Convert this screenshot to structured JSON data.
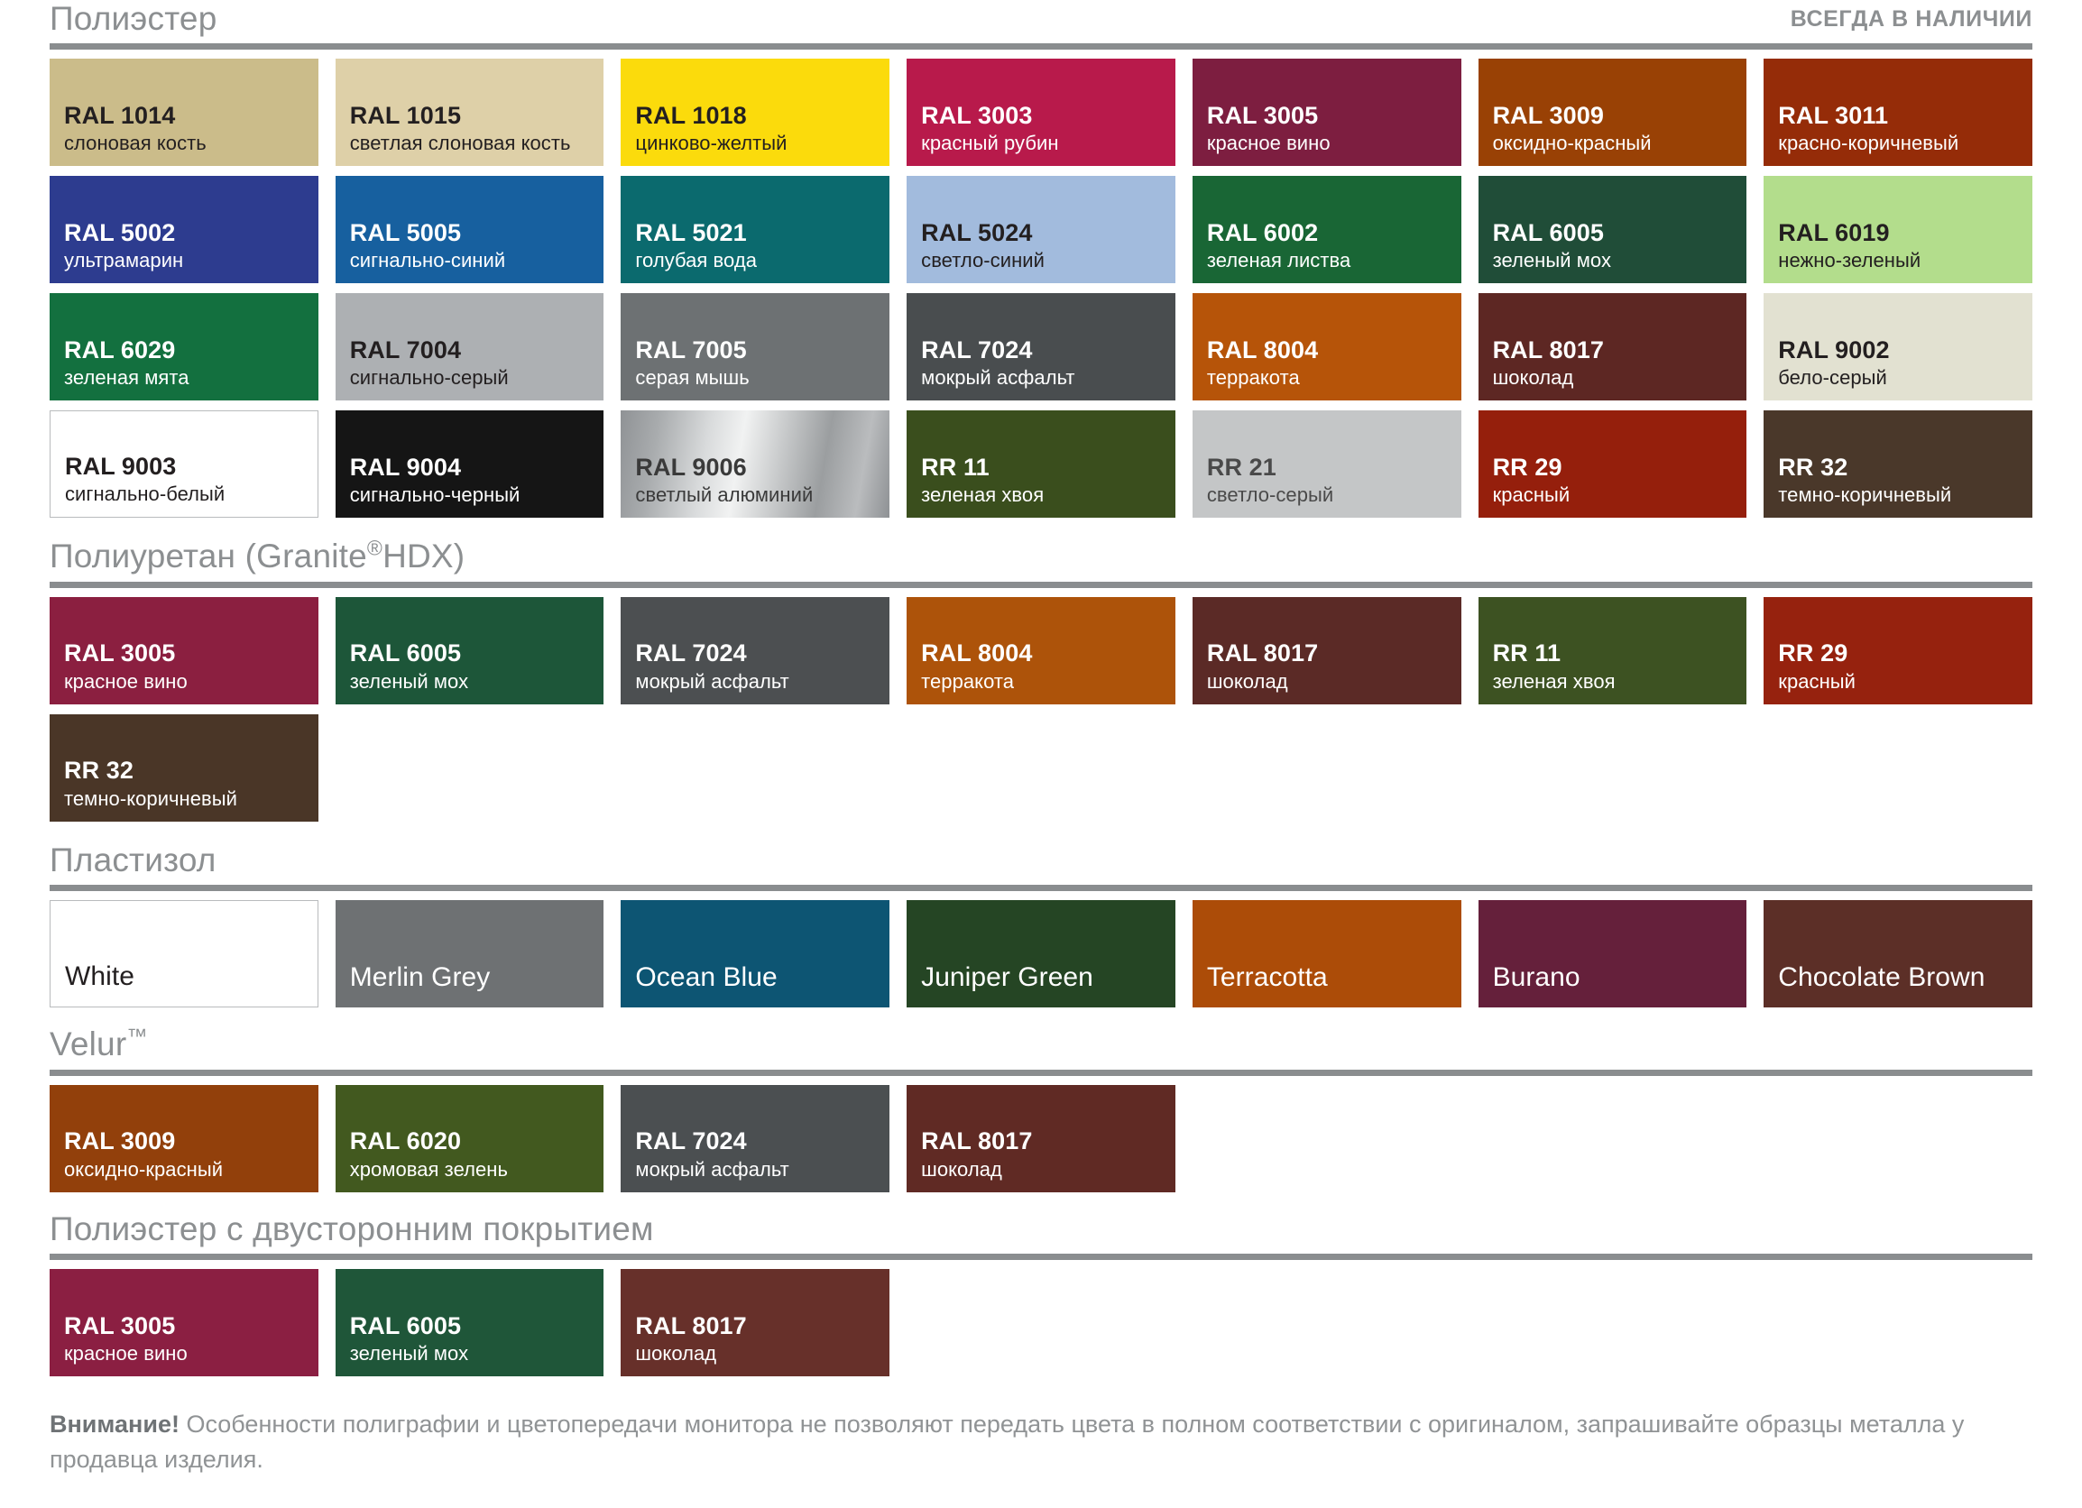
{
  "header": {
    "badge": "ВСЕГДА В НАЛИЧИИ"
  },
  "sections": [
    {
      "id": "polyester",
      "title": "Полиэстер",
      "swatches": [
        {
          "code": "RAL 1014",
          "name": "слоновая кость",
          "bg": "#cbbc8a",
          "fg": "#231f20"
        },
        {
          "code": "RAL 1015",
          "name": "светлая слоновая кость",
          "bg": "#ded0a8",
          "fg": "#231f20"
        },
        {
          "code": "RAL 1018",
          "name": "цинково-желтый",
          "bg": "#fbdb0c",
          "fg": "#231f20"
        },
        {
          "code": "RAL 3003",
          "name": "красный рубин",
          "bg": "#b81a4b",
          "fg": "#ffffff"
        },
        {
          "code": "RAL 3005",
          "name": "красное вино",
          "bg": "#7d1e40",
          "fg": "#ffffff"
        },
        {
          "code": "RAL 3009",
          "name": "оксидно-красный",
          "bg": "#994105",
          "fg": "#ffffff"
        },
        {
          "code": "RAL 3011",
          "name": "красно-коричневый",
          "bg": "#952c08",
          "fg": "#ffffff"
        },
        {
          "code": "RAL 5002",
          "name": "ультрамарин",
          "bg": "#2d3c8f",
          "fg": "#ffffff"
        },
        {
          "code": "RAL 5005",
          "name": "сигнально-синий",
          "bg": "#17609f",
          "fg": "#ffffff"
        },
        {
          "code": "RAL 5021",
          "name": "голубая вода",
          "bg": "#0b6a6e",
          "fg": "#ffffff"
        },
        {
          "code": "RAL 5024",
          "name": "светло-синий",
          "bg": "#a2bbdd",
          "fg": "#231f20"
        },
        {
          "code": "RAL 6002",
          "name": "зеленая листва",
          "bg": "#196635",
          "fg": "#ffffff"
        },
        {
          "code": "RAL 6005",
          "name": "зеленый мох",
          "bg": "#204d38",
          "fg": "#ffffff"
        },
        {
          "code": "RAL 6019",
          "name": "нежно-зеленый",
          "bg": "#b3dd8c",
          "fg": "#231f20"
        },
        {
          "code": "RAL 6029",
          "name": "зеленая мята",
          "bg": "#13703f",
          "fg": "#ffffff"
        },
        {
          "code": "RAL 7004",
          "name": "сигнально-серый",
          "bg": "#adb0b3",
          "fg": "#231f20"
        },
        {
          "code": "RAL 7005",
          "name": "серая мышь",
          "bg": "#6d7173",
          "fg": "#ffffff"
        },
        {
          "code": "RAL 7024",
          "name": "мокрый асфальт",
          "bg": "#494d4f",
          "fg": "#ffffff"
        },
        {
          "code": "RAL 8004",
          "name": "терракота",
          "bg": "#b65409",
          "fg": "#ffffff"
        },
        {
          "code": "RAL 8017",
          "name": "шоколад",
          "bg": "#5d2723",
          "fg": "#ffffff"
        },
        {
          "code": "RAL 9002",
          "name": "бело-серый",
          "bg": "#e2e1d1",
          "fg": "#231f20"
        },
        {
          "code": "RAL 9003",
          "name": "сигнально-белый",
          "bg": "#ffffff",
          "fg": "#231f20",
          "bordered": true
        },
        {
          "code": "RAL 9004",
          "name": "сигнально-черный",
          "bg": "#151515",
          "fg": "#ffffff"
        },
        {
          "code": "RAL 9006",
          "name": "светлый алюминий",
          "bg": "#a8abad",
          "fg": "#3a3a3a",
          "metallic": true
        },
        {
          "code": "RR 11",
          "name": "зеленая хвоя",
          "bg": "#3a4e1d",
          "fg": "#ffffff"
        },
        {
          "code": "RR 21",
          "name": "светло-серый",
          "bg": "#c4c6c7",
          "fg": "#4a4a4a"
        },
        {
          "code": "RR 29",
          "name": "красный",
          "bg": "#951f0c",
          "fg": "#ffffff"
        },
        {
          "code": "RR 32",
          "name": "темно-коричневый",
          "bg": "#4a382a",
          "fg": "#ffffff"
        }
      ]
    },
    {
      "id": "polyurethane",
      "title": "Полиуретан (Granite",
      "title_sup": "®",
      "title_tail": "HDX)",
      "swatches": [
        {
          "code": "RAL 3005",
          "name": "красное вино",
          "bg": "#8b1f40",
          "fg": "#ffffff"
        },
        {
          "code": "RAL 6005",
          "name": "зеленый мох",
          "bg": "#1d5639",
          "fg": "#ffffff"
        },
        {
          "code": "RAL 7024",
          "name": "мокрый асфальт",
          "bg": "#4c4f51",
          "fg": "#ffffff"
        },
        {
          "code": "RAL 8004",
          "name": "терракота",
          "bg": "#ad530a",
          "fg": "#ffffff"
        },
        {
          "code": "RAL 8017",
          "name": "шоколад",
          "bg": "#5b2a26",
          "fg": "#ffffff"
        },
        {
          "code": "RR 11",
          "name": "зеленая хвоя",
          "bg": "#3d5222",
          "fg": "#ffffff"
        },
        {
          "code": "RR 29",
          "name": "красный",
          "bg": "#96220e",
          "fg": "#ffffff"
        },
        {
          "code": "RR 32",
          "name": "темно-коричневый",
          "bg": "#4a3627",
          "fg": "#ffffff"
        }
      ]
    },
    {
      "id": "plastisol",
      "title": "Пластизол",
      "swatches": [
        {
          "name": "White",
          "bg": "#ffffff",
          "fg": "#231f20",
          "bordered": true
        },
        {
          "name": "Merlin Grey",
          "bg": "#6e7173",
          "fg": "#ffffff"
        },
        {
          "name": "Ocean Blue",
          "bg": "#0d5573",
          "fg": "#ffffff"
        },
        {
          "name": "Juniper Green",
          "bg": "#254524",
          "fg": "#ffffff"
        },
        {
          "name": "Terracotta",
          "bg": "#ac4c08",
          "fg": "#ffffff"
        },
        {
          "name": "Burano",
          "bg": "#65203b",
          "fg": "#ffffff"
        },
        {
          "name": "Chocolate Brown",
          "bg": "#5c2f27",
          "fg": "#ffffff"
        }
      ]
    },
    {
      "id": "velur",
      "title": "Velur",
      "title_sup": "™",
      "swatches": [
        {
          "code": "RAL 3009",
          "name": "оксидно-красный",
          "bg": "#92400b",
          "fg": "#ffffff"
        },
        {
          "code": "RAL 6020",
          "name": "хромовая зелень",
          "bg": "#42591f",
          "fg": "#ffffff"
        },
        {
          "code": "RAL 7024",
          "name": "мокрый асфальт",
          "bg": "#4b4f51",
          "fg": "#ffffff"
        },
        {
          "code": "RAL 8017",
          "name": "шоколад",
          "bg": "#602a24",
          "fg": "#ffffff"
        }
      ]
    },
    {
      "id": "polyester-double",
      "title": "Полиэстер с двусторонним покрытием",
      "swatches": [
        {
          "code": "RAL 3005",
          "name": "красное вино",
          "bg": "#8b1f42",
          "fg": "#ffffff"
        },
        {
          "code": "RAL 6005",
          "name": "зеленый мох",
          "bg": "#1f5639",
          "fg": "#ffffff"
        },
        {
          "code": "RAL 8017",
          "name": "шоколад",
          "bg": "#67302a",
          "fg": "#ffffff"
        }
      ]
    }
  ],
  "footer": {
    "bold": "Внимание!",
    "text": " Особенности полиграфии и цветопередачи монитора не позволяют передать цвета в полном соответствии с оригиналом, запрашивайте образцы металла у продавца изделия."
  }
}
